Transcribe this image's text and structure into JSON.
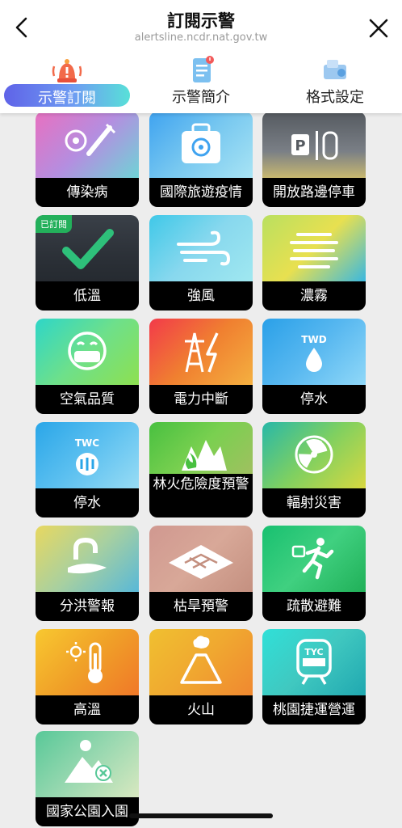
{
  "header": {
    "title": "訂閱示警",
    "url": "alertsline.ncdr.nat.gov.tw"
  },
  "tabs": [
    {
      "label": "示警訂閱",
      "icon": "alarm-bell-icon",
      "active": true
    },
    {
      "label": "示警簡介",
      "icon": "document-icon",
      "active": false
    },
    {
      "label": "格式設定",
      "icon": "settings-icon",
      "active": false
    }
  ],
  "cards": [
    {
      "label": "傳染病",
      "icon": "virus-syringe-icon",
      "subscribed": false,
      "colors": [
        "#e870c0",
        "#b48ee0",
        "#6fd3d6"
      ]
    },
    {
      "label": "國際旅遊疫情",
      "icon": "biohazard-luggage-icon",
      "subscribed": false,
      "colors": [
        "#3fa3f0",
        "#78c8f0",
        "#a8e4f4"
      ]
    },
    {
      "label": "開放路邊停車",
      "icon": "parking-car-icon",
      "subscribed": false,
      "colors": [
        "#555a60",
        "#7a7f86",
        "#c8b870"
      ]
    },
    {
      "label": "低溫",
      "icon": "checkmark-icon",
      "subscribed": true,
      "badge": "已訂閱",
      "colors": [
        "#3a4048",
        "#2c3138",
        "#252a30"
      ]
    },
    {
      "label": "強風",
      "icon": "wind-icon",
      "subscribed": false,
      "colors": [
        "#3fc8e8",
        "#88d8ee",
        "#a0e8f0"
      ]
    },
    {
      "label": "濃霧",
      "icon": "fog-icon",
      "subscribed": false,
      "colors": [
        "#b9e060",
        "#e8e050",
        "#3ab8e0"
      ]
    },
    {
      "label": "空氣品質",
      "icon": "face-mask-icon",
      "subscribed": false,
      "colors": [
        "#2ed6c8",
        "#6ee08a",
        "#8ee050"
      ]
    },
    {
      "label": "電力中斷",
      "icon": "power-tower-icon",
      "subscribed": false,
      "colors": [
        "#f23a4a",
        "#f08030",
        "#f4b040"
      ]
    },
    {
      "label": "停水",
      "tag": "TWD",
      "icon": "water-drop-icon",
      "subscribed": false,
      "colors": [
        "#2aa0e8",
        "#58b8f0",
        "#90d8f8"
      ]
    },
    {
      "label": "停水",
      "tag": "TWC",
      "icon": "water-company-icon",
      "subscribed": false,
      "colors": [
        "#2aa6e8",
        "#5cc0f0",
        "#98dcf4"
      ]
    },
    {
      "label": "林火危險度預警",
      "icon": "forest-fire-icon",
      "subscribed": false,
      "colors": [
        "#48c040",
        "#7ad050",
        "#a0c060"
      ]
    },
    {
      "label": "輻射災害",
      "icon": "radiation-icon",
      "subscribed": false,
      "colors": [
        "#28b8a8",
        "#80d060",
        "#d8d840"
      ]
    },
    {
      "label": "分洪警報",
      "icon": "flood-channel-icon",
      "subscribed": false,
      "colors": [
        "#e8d860",
        "#a8d0a0",
        "#58b8d8"
      ]
    },
    {
      "label": "枯旱預警",
      "icon": "cracked-ground-icon",
      "subscribed": false,
      "colors": [
        "#d09890",
        "#d8a898",
        "#c49080"
      ]
    },
    {
      "label": "疏散避難",
      "icon": "evacuation-run-icon",
      "subscribed": false,
      "colors": [
        "#18c070",
        "#40d080",
        "#20b058"
      ]
    },
    {
      "label": "高溫",
      "icon": "thermometer-sun-icon",
      "subscribed": false,
      "colors": [
        "#f8c830",
        "#f0a028",
        "#f07828"
      ]
    },
    {
      "label": "火山",
      "icon": "volcano-icon",
      "subscribed": false,
      "colors": [
        "#f0c030",
        "#f0a830",
        "#f08830"
      ]
    },
    {
      "label": "桃園捷運營運",
      "tag": "TYC",
      "icon": "metro-train-icon",
      "subscribed": false,
      "colors": [
        "#30e0d8",
        "#40c8c0",
        "#20a8b0"
      ]
    },
    {
      "label": "國家公園入園",
      "icon": "mountain-park-icon",
      "subscribed": false,
      "colors": [
        "#58c898",
        "#98d8b0",
        "#d8e8c0"
      ]
    }
  ]
}
